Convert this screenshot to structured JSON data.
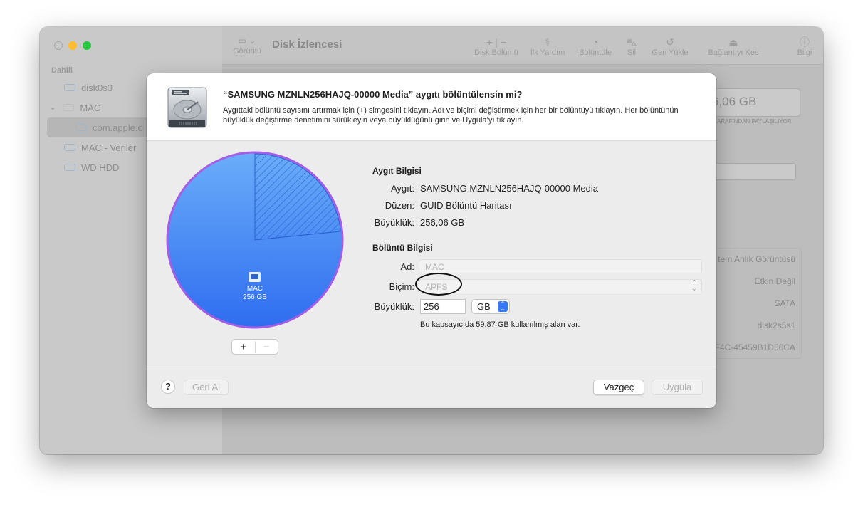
{
  "background_window": {
    "title": "Disk İzlencesi",
    "view_label": "Görüntü",
    "toolbar": [
      {
        "label": "Disk Bölümü",
        "icon": "plus-minus-icon"
      },
      {
        "label": "İlk Yardım",
        "icon": "stethoscope-icon"
      },
      {
        "label": "Bölüntüle",
        "icon": "pie-icon"
      },
      {
        "label": "Sil",
        "icon": "eraser-icon"
      },
      {
        "label": "Geri Yükle",
        "icon": "restore-icon"
      },
      {
        "label": "Bağlantıyı Kes",
        "icon": "eject-icon"
      },
      {
        "label": "Bilgi",
        "icon": "info-icon"
      }
    ],
    "sidebar": {
      "section": "Dahili",
      "items": [
        {
          "label": "disk0s3"
        },
        {
          "label": "MAC"
        },
        {
          "label": "com.apple.o"
        },
        {
          "label": "MAC - Veriler"
        },
        {
          "label": "WD HDD"
        }
      ]
    },
    "main": {
      "capacity": "6,06 GB",
      "shared_by": "ARAFINDAN PAYLAŞILIYOR",
      "rows": [
        "tem Anlık Görüntüsü",
        "Etkin Değil",
        "SATA",
        "disk2s5s1",
        "F4C-45459B1D56CA"
      ]
    }
  },
  "dialog": {
    "title": "“SAMSUNG MZNLN256HAJQ-00000 Media” aygıtı bölüntülensin mi?",
    "description": "Aygıttaki bölüntü sayısını artırmak için (+) simgesini tıklayın. Adı ve biçimi değiştirmek için her bir bölüntüyü tıklayın. Her bölüntünün büyüklük değiştirme denetimini sürükleyin veya büyüklüğünü girin ve Uygula’yı tıklayın.",
    "pie": {
      "partition_name": "MAC",
      "partition_size": "256 GB",
      "used_fraction": 0.234,
      "colors": {
        "fill_top": "#6aadf9",
        "fill_bottom": "#2f6df0",
        "ring": "#a45ee6"
      }
    },
    "add_label": "+",
    "remove_label": "−",
    "device_info": {
      "heading": "Aygıt Bilgisi",
      "device_label": "Aygıt:",
      "device_value": "SAMSUNG MZNLN256HAJQ-00000 Media",
      "scheme_label": "Düzen:",
      "scheme_value": "GUID Bölüntü Haritası",
      "size_label": "Büyüklük:",
      "size_value": "256,06 GB"
    },
    "partition_info": {
      "heading": "Bölüntü Bilgisi",
      "name_label": "Ad:",
      "name_placeholder": "MAC",
      "format_label": "Biçim:",
      "format_value": "APFS",
      "size_label": "Büyüklük:",
      "size_value": "256",
      "unit_value": "GB",
      "note": "Bu kapsayıcıda 59,87 GB kullanılmış alan var."
    },
    "help_label": "?",
    "revert_label": "Geri Al",
    "cancel_label": "Vazgeç",
    "apply_label": "Uygula"
  }
}
